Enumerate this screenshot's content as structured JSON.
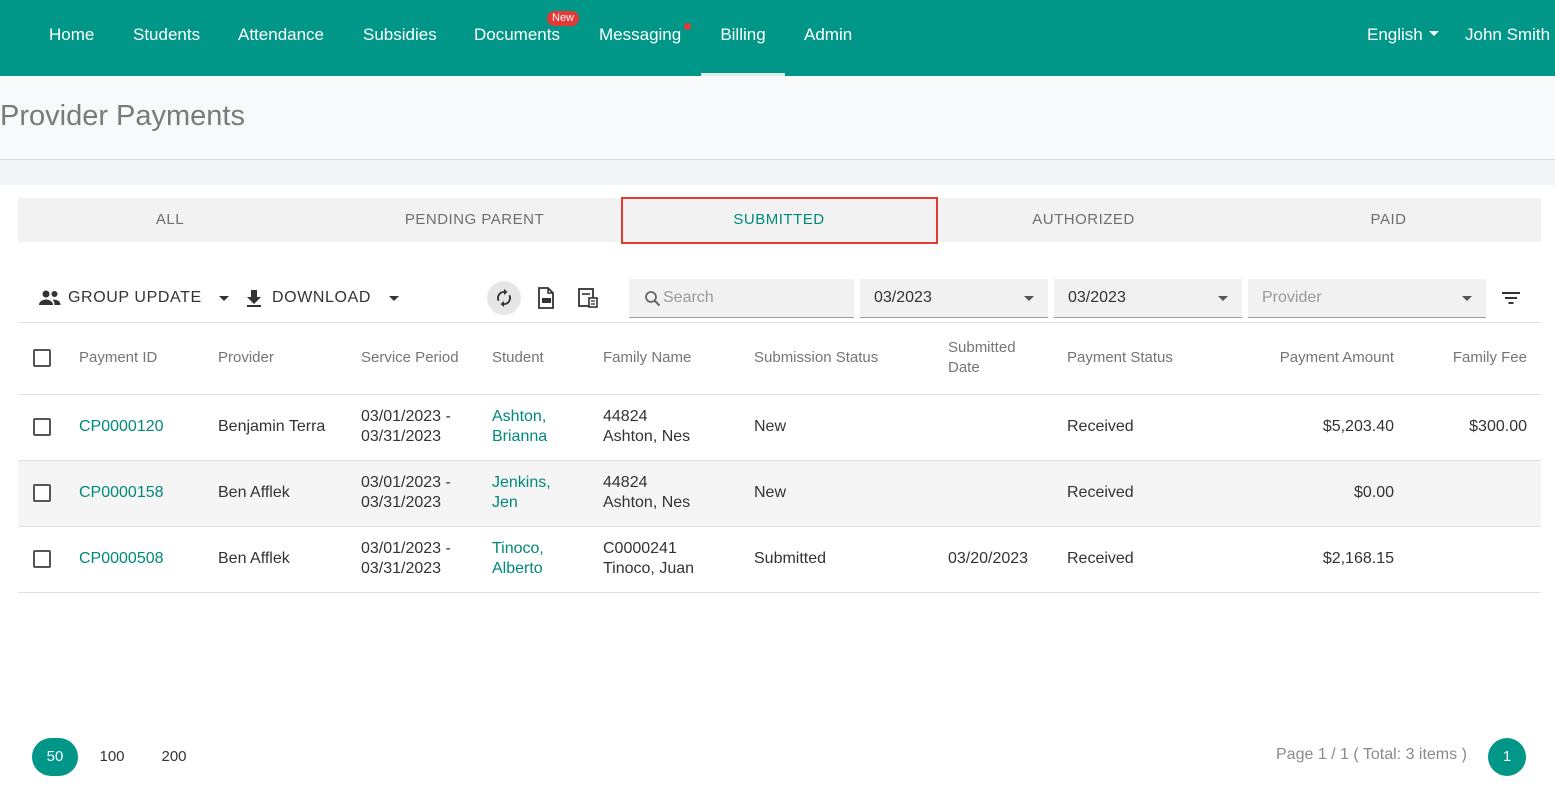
{
  "nav": {
    "items": [
      {
        "label": "Home"
      },
      {
        "label": "Students"
      },
      {
        "label": "Attendance"
      },
      {
        "label": "Subsidies"
      },
      {
        "label": "Documents",
        "badge": "New"
      },
      {
        "label": "Messaging"
      },
      {
        "label": "Billing"
      },
      {
        "label": "Admin"
      }
    ],
    "active": "Billing",
    "language": "English",
    "user": "John Smith"
  },
  "page": {
    "title": "Provider Payments"
  },
  "tabs": [
    {
      "label": "ALL"
    },
    {
      "label": "PENDING PARENT"
    },
    {
      "label": "SUBMITTED"
    },
    {
      "label": "AUTHORIZED"
    },
    {
      "label": "PAID"
    }
  ],
  "active_tab": "SUBMITTED",
  "toolbar": {
    "group_update": "GROUP UPDATE",
    "download": "DOWNLOAD",
    "search_placeholder": "Search",
    "from_period": "03/2023",
    "to_period": "03/2023",
    "provider_placeholder": "Provider"
  },
  "table": {
    "headers": {
      "payment_id": "Payment ID",
      "provider": "Provider",
      "service_period": "Service Period",
      "student": "Student",
      "family_name": "Family Name",
      "submission_status": "Submission Status",
      "submitted_date_1": "Submitted",
      "submitted_date_2": "Date",
      "payment_status": "Payment Status",
      "payment_amount": "Payment Amount",
      "family_fee": "Family Fee"
    },
    "rows": [
      {
        "payment_id": "CP0000120",
        "provider": "Benjamin Terra",
        "period_1": "03/01/2023 -",
        "period_2": "03/31/2023",
        "student_1": "Ashton,",
        "student_2": "Brianna",
        "family_1": "44824",
        "family_2": "Ashton, Nes",
        "submission_status": "New",
        "submitted_date": "",
        "payment_status": "Received",
        "payment_amount": "$5,203.40",
        "family_fee": "$300.00"
      },
      {
        "payment_id": "CP0000158",
        "provider": "Ben Afflek",
        "period_1": "03/01/2023 -",
        "period_2": "03/31/2023",
        "student_1": "Jenkins,",
        "student_2": "Jen",
        "family_1": "44824",
        "family_2": "Ashton, Nes",
        "submission_status": "New",
        "submitted_date": "",
        "payment_status": "Received",
        "payment_amount": "$0.00",
        "family_fee": ""
      },
      {
        "payment_id": "CP0000508",
        "provider": "Ben Afflek",
        "period_1": "03/01/2023 -",
        "period_2": "03/31/2023",
        "student_1": "Tinoco,",
        "student_2": "Alberto",
        "family_1": "C0000241",
        "family_2": "Tinoco, Juan",
        "submission_status": "Submitted",
        "submitted_date": "03/20/2023",
        "payment_status": "Received",
        "payment_amount": "$2,168.15",
        "family_fee": ""
      }
    ]
  },
  "pagination": {
    "page_sizes": [
      "50",
      "100",
      "200"
    ],
    "active_size": "50",
    "summary": "Page 1 / 1 ( Total: 3 items )",
    "current_page": "1"
  },
  "colors": {
    "primary": "#009688",
    "link": "#00897b",
    "highlight": "#e53935"
  }
}
